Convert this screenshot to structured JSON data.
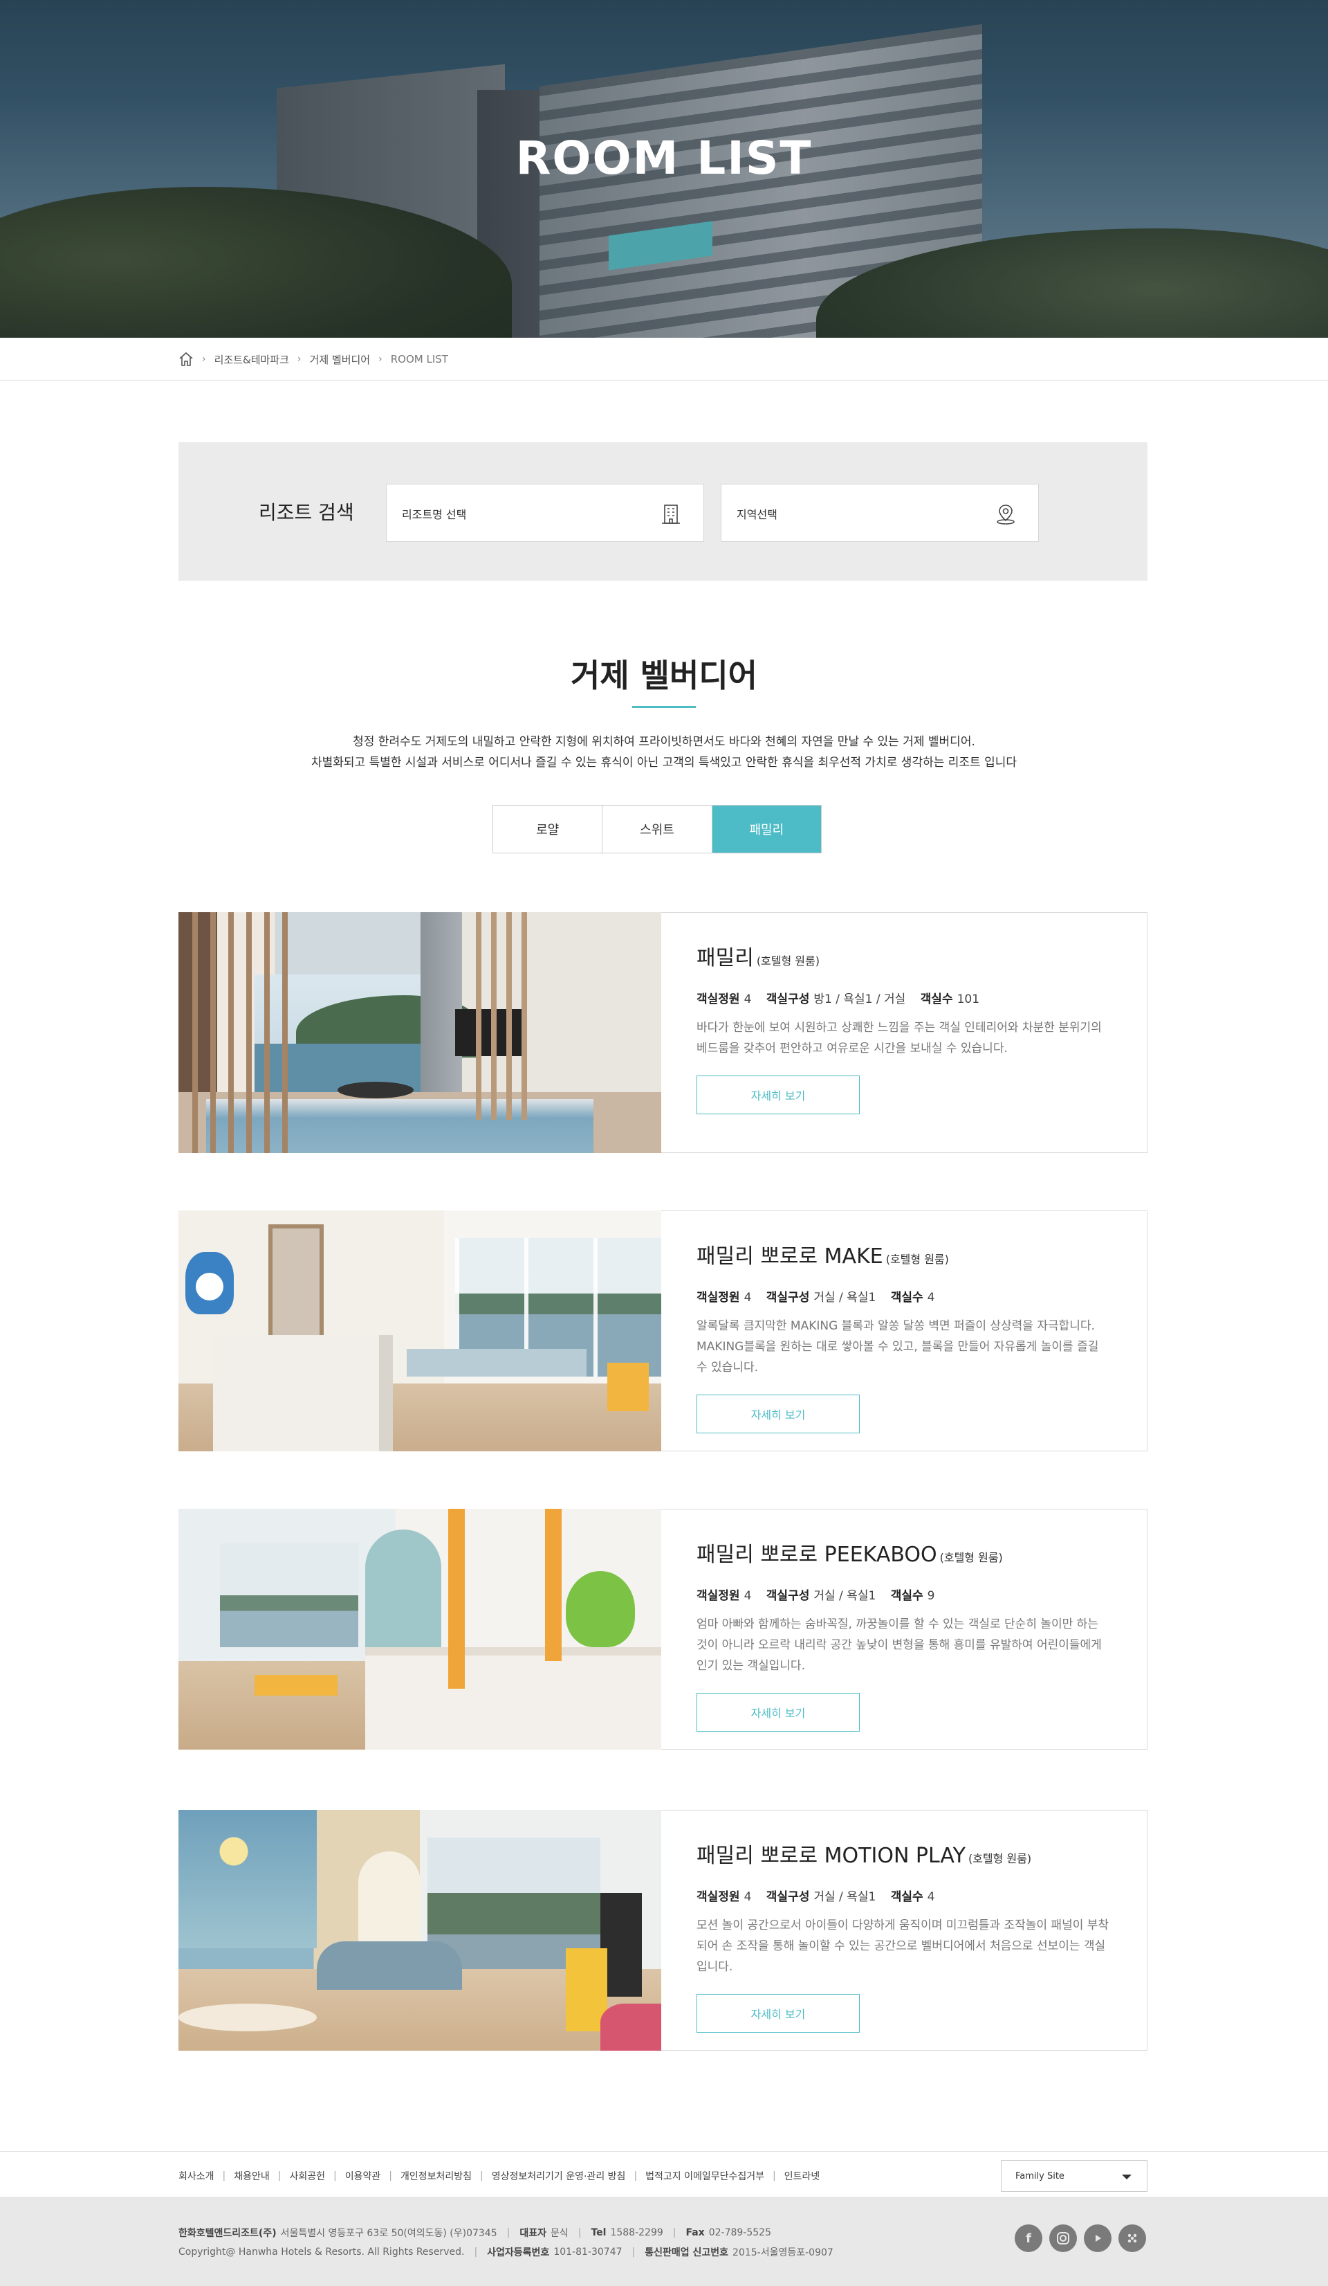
{
  "hero": {
    "title": "ROOM LIST"
  },
  "breadcrumb": {
    "items": [
      "리조트&테마파크",
      "거제 벨버디어",
      "ROOM LIST"
    ]
  },
  "search": {
    "label": "리조트 검색",
    "resort_placeholder": "리조트명 선택",
    "region_placeholder": "지역선택"
  },
  "intro": {
    "title": "거제 벨버디어",
    "line1": "청정 한려수도 거제도의 내밀하고 안락한 지형에 위치하여 프라이빗하면서도 바다와 천혜의 자연을 만날 수 있는 거제 벨버디어.",
    "line2": "차별화되고 특별한 시설과 서비스로 어디서나 즐길 수 있는 휴식이 아닌 고객의 특색있고 안락한 휴식을 최우선적 가치로 생각하는 리조트 입니다"
  },
  "tabs": [
    {
      "label": "로얄",
      "active": false
    },
    {
      "label": "스위트",
      "active": false
    },
    {
      "label": "패밀리",
      "active": true
    }
  ],
  "rooms": [
    {
      "name": "패밀리",
      "sub": "(호텔형 원룸)",
      "cap_label": "객실정원",
      "cap": "4",
      "comp_label": "객실구성",
      "comp": "방1 / 욕실1 / 거실",
      "count_label": "객실수",
      "count": "101",
      "desc": "바다가 한눈에 보여 시원하고 상쾌한 느낌을 주는 객실 인테리어와 차분한 분위기의 베드룸을 갖추어 편안하고 여유로운 시간을 보내실 수 있습니다.",
      "button": "자세히 보기"
    },
    {
      "name": "패밀리 뽀로로 MAKE",
      "sub": "(호텔형 원룸)",
      "cap_label": "객실정원",
      "cap": "4",
      "comp_label": "객실구성",
      "comp": "거실 / 욕실1",
      "count_label": "객실수",
      "count": "4",
      "desc": "알록달록 큼지막한 MAKING 블록과 알쏭 달쏭 벽면 퍼즐이 상상력을 자극합니다. MAKING블록을 원하는 대로 쌓아볼 수 있고, 블록을 만들어 자유롭게 놀이를 즐길 수 있습니다.",
      "button": "자세히 보기"
    },
    {
      "name": "패밀리 뽀로로 PEEKABOO",
      "sub": "(호텔형 원룸)",
      "cap_label": "객실정원",
      "cap": "4",
      "comp_label": "객실구성",
      "comp": "거실 / 욕실1",
      "count_label": "객실수",
      "count": "9",
      "desc": "엄마 아빠와 함께하는 숨바꼭질, 까꿍놀이를 할 수 있는 객실로 단순히 놀이만 하는 것이 아니라 오르락 내리락 공간 높낮이 변형을 통해 흥미를 유발하여 어린이들에게 인기 있는 객실입니다.",
      "button": "자세히 보기"
    },
    {
      "name": "패밀리 뽀로로 MOTION PLAY",
      "sub": "(호텔형 원룸)",
      "cap_label": "객실정원",
      "cap": "4",
      "comp_label": "객실구성",
      "comp": "거실 / 욕실1",
      "count_label": "객실수",
      "count": "4",
      "desc": "모션 놀이 공간으로서 아이들이 다양하게 움직이며 미끄럼틀과 조작놀이 패널이 부착되어 손 조작을 통해 놀이할 수 있는 공간으로 벨버디어에서 처음으로 선보이는 객실입니다.",
      "button": "자세히 보기"
    }
  ],
  "footer": {
    "links": [
      "회사소개",
      "채용안내",
      "사회공헌",
      "이용약관",
      "개인정보처리방침",
      "영상정보처리기기 운영·관리 방침",
      "법적고지 이메일무단수집거부",
      "인트라넷"
    ],
    "family_site": "Family Site",
    "company": "한화호텔앤드리조트(주)",
    "address": "서울특별시 영등포구 63로 50(여의도동) (우)07345",
    "ceo_label": "대표자",
    "ceo": "문식",
    "tel_label": "Tel",
    "tel": "1588-2299",
    "fax_label": "Fax",
    "fax": "02-789-5525",
    "copyright": "Copyright@ Hanwha Hotels & Resorts. All Rights Reserved.",
    "biz_label": "사업자등록번호",
    "biz": "101-81-30747",
    "mail_label": "통신판매업 신고번호",
    "mail": "2015-서울영등포-0907",
    "social": [
      "facebook-icon",
      "instagram-icon",
      "youtube-icon",
      "app-icon"
    ]
  }
}
